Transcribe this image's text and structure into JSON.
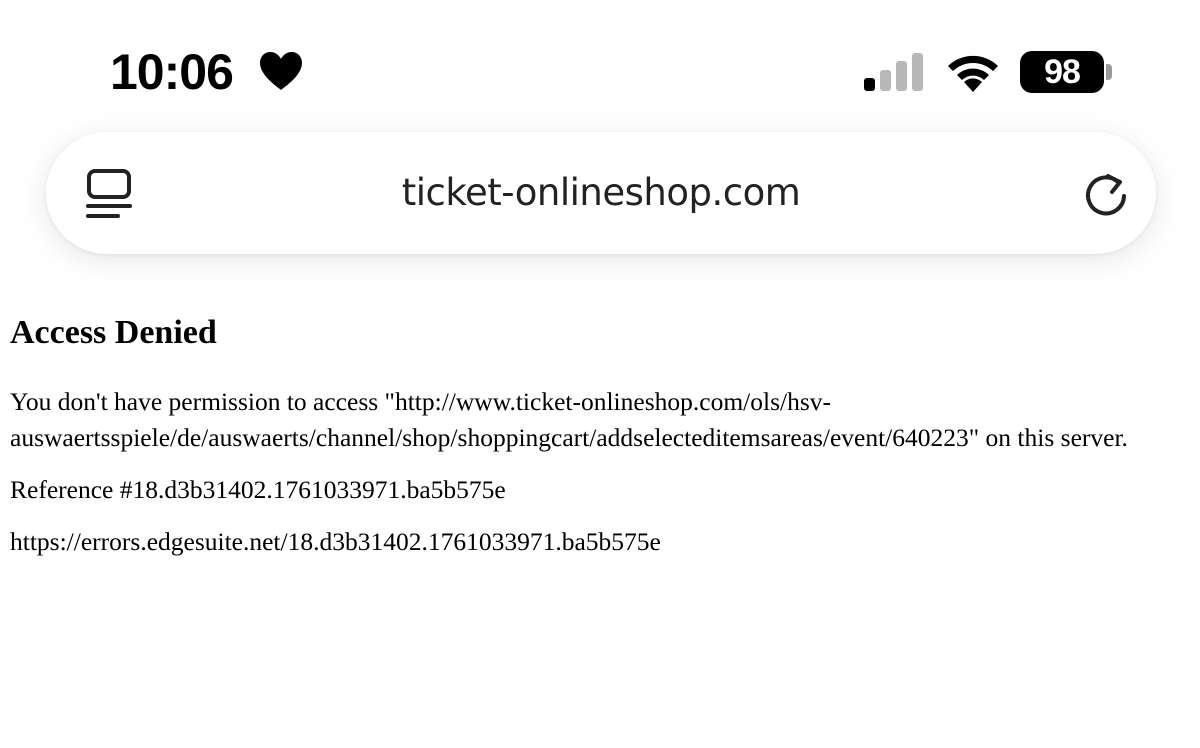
{
  "status_bar": {
    "time": "10:06",
    "battery_level": "98",
    "signal_bars_active": 1,
    "signal_bars_total": 4
  },
  "browser": {
    "url": "ticket-onlineshop.com"
  },
  "page": {
    "title": "Access Denied",
    "message": "You don't have permission to access \"http://www.ticket-onlineshop.com/ols/hsv-auswaertsspiele/de/auswaerts/channel/shop/shoppingcart/addselecteditemsareas/event/640223\" on this server.",
    "reference": "Reference #18.d3b31402.1761033971.ba5b575e",
    "error_url": "https://errors.edgesuite.net/18.d3b31402.1761033971.ba5b575e"
  },
  "colors": {
    "text": "#000000",
    "background": "#ffffff",
    "inactive_signal": "#b8b8b8"
  }
}
